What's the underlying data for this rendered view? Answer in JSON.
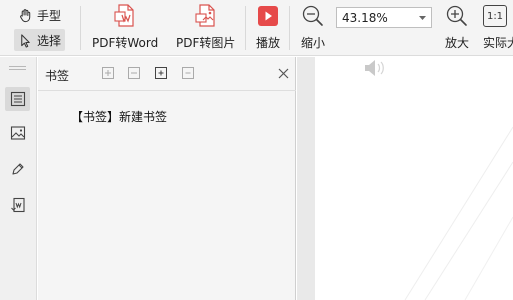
{
  "toolbar": {
    "hand_label": "手型",
    "select_label": "选择",
    "pdf_to_word_label": "PDF转Word",
    "pdf_to_image_label": "PDF转图片",
    "play_label": "播放",
    "zoom_out_label": "缩小",
    "zoom_value": "43.18%",
    "zoom_in_label": "放大",
    "actual_size_label": "实际大",
    "actual_size_icon_text": "1:1"
  },
  "panel": {
    "title": "书签",
    "bookmarks": [
      {
        "label": "【书签】新建书签"
      }
    ]
  },
  "colors": {
    "play_button": "#e64a4a",
    "pdf_icon_red": "#d9534f",
    "active_bg": "#dedede",
    "panel_bg": "#f5f5f5"
  }
}
